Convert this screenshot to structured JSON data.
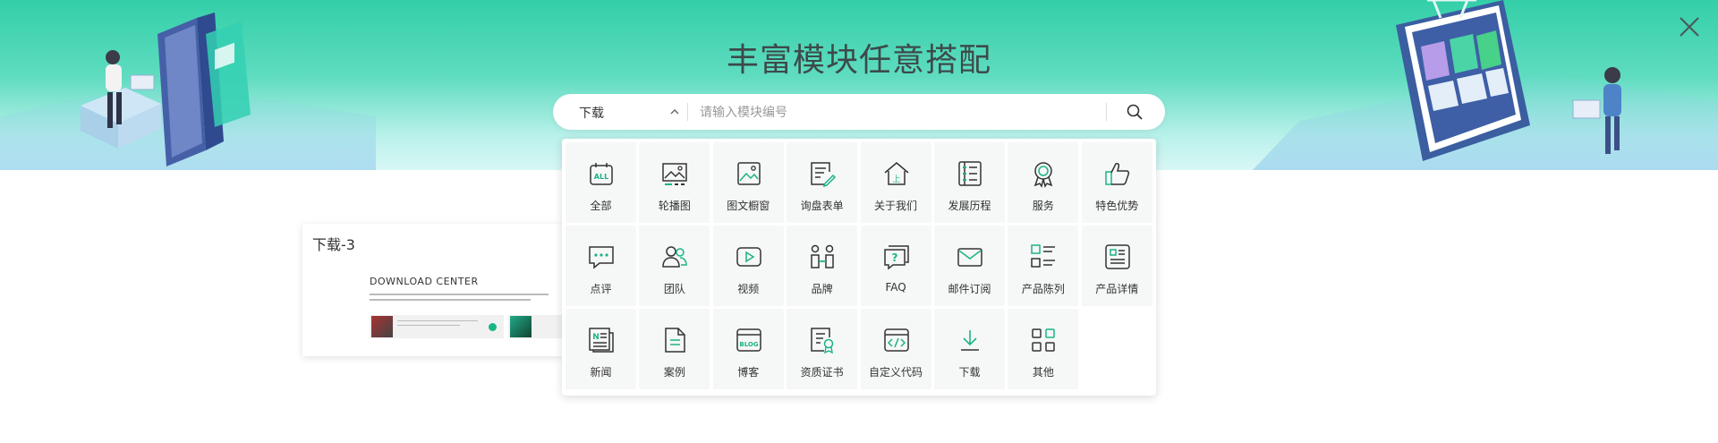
{
  "header": {
    "title": "丰富模块任意搭配"
  },
  "search": {
    "selected_category": "下载",
    "placeholder": "请输入模块编号"
  },
  "categories": [
    {
      "label": "全部",
      "icon": "all-icon"
    },
    {
      "label": "轮播图",
      "icon": "image-carousel-icon"
    },
    {
      "label": "图文橱窗",
      "icon": "picture-icon"
    },
    {
      "label": "询盘表单",
      "icon": "form-edit-icon"
    },
    {
      "label": "关于我们",
      "icon": "home-icon"
    },
    {
      "label": "发展历程",
      "icon": "timeline-icon"
    },
    {
      "label": "服务",
      "icon": "award-icon"
    },
    {
      "label": "特色优势",
      "icon": "thumbs-up-icon"
    },
    {
      "label": "点评",
      "icon": "comment-icon"
    },
    {
      "label": "团队",
      "icon": "team-icon"
    },
    {
      "label": "视频",
      "icon": "video-icon"
    },
    {
      "label": "品牌",
      "icon": "brand-icon"
    },
    {
      "label": "FAQ",
      "icon": "faq-icon"
    },
    {
      "label": "邮件订阅",
      "icon": "mail-icon"
    },
    {
      "label": "产品陈列",
      "icon": "product-list-icon"
    },
    {
      "label": "产品详情",
      "icon": "product-detail-icon"
    },
    {
      "label": "新闻",
      "icon": "news-icon"
    },
    {
      "label": "案例",
      "icon": "case-file-icon"
    },
    {
      "label": "博客",
      "icon": "blog-icon"
    },
    {
      "label": "资质证书",
      "icon": "certificate-icon"
    },
    {
      "label": "自定义代码",
      "icon": "code-icon"
    },
    {
      "label": "下载",
      "icon": "download-icon"
    },
    {
      "label": "其他",
      "icon": "other-grid-icon"
    }
  ],
  "preview": {
    "title": "下载-3",
    "heading": "DOWNLOAD CENTER"
  },
  "colors": {
    "accent": "#1bb487",
    "banner_top": "#33cfa8",
    "banner_bottom": "#d8f7f6",
    "icon_stroke": "#333333"
  }
}
